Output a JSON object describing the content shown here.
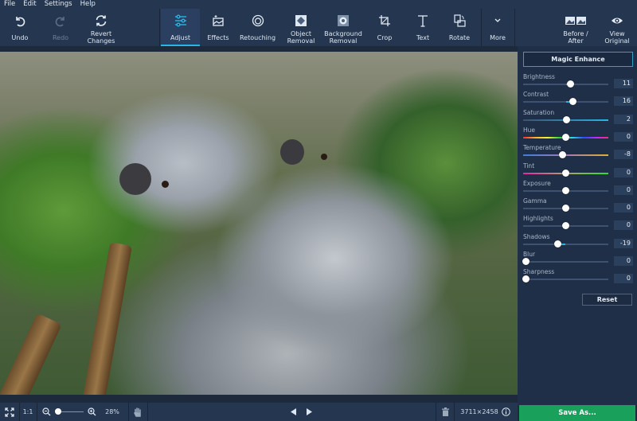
{
  "menu": [
    "File",
    "Edit",
    "Settings",
    "Help"
  ],
  "toolbar": {
    "undo": "Undo",
    "redo": "Redo",
    "revert": "Revert Changes",
    "tools": [
      {
        "label": "Adjust",
        "icon": "sliders-icon",
        "active": true
      },
      {
        "label": "Effects",
        "icon": "effects-icon"
      },
      {
        "label": "Retouching",
        "icon": "retouching-icon"
      },
      {
        "label": "Object Removal",
        "icon": "object-removal-icon"
      },
      {
        "label": "Background Removal",
        "icon": "background-removal-icon"
      },
      {
        "label": "Crop",
        "icon": "crop-icon"
      },
      {
        "label": "Text",
        "icon": "text-icon"
      },
      {
        "label": "Rotate",
        "icon": "rotate-icon"
      }
    ],
    "more": "More",
    "before_after": "Before / After",
    "view_original": "View Original"
  },
  "panel": {
    "magic_enhance": "Magic Enhance",
    "sliders": [
      {
        "name": "Brightness",
        "value": "11",
        "pos": 0.56,
        "fill_from": 0.5,
        "track": "plain"
      },
      {
        "name": "Contrast",
        "value": "16",
        "pos": 0.58,
        "fill_from": 0.5,
        "track": "plain"
      },
      {
        "name": "Saturation",
        "value": "2",
        "pos": 0.51,
        "fill_from": 0.5,
        "track": "cyan"
      },
      {
        "name": "Hue",
        "value": "0",
        "pos": 0.5,
        "track": "rainbow"
      },
      {
        "name": "Temperature",
        "value": "-8",
        "pos": 0.46,
        "track": "temp"
      },
      {
        "name": "Tint",
        "value": "0",
        "pos": 0.5,
        "track": "tint"
      },
      {
        "name": "Exposure",
        "value": "0",
        "pos": 0.5,
        "track": "plain"
      },
      {
        "name": "Gamma",
        "value": "0",
        "pos": 0.5,
        "track": "plain"
      },
      {
        "name": "Highlights",
        "value": "0",
        "pos": 0.5,
        "track": "plain"
      },
      {
        "name": "Shadows",
        "value": "-19",
        "pos": 0.41,
        "fill_from": 0.5,
        "track": "plain"
      },
      {
        "name": "Blur",
        "value": "0",
        "pos": 0.0,
        "track": "plain"
      },
      {
        "name": "Sharpness",
        "value": "0",
        "pos": 0.0,
        "track": "plain"
      }
    ],
    "reset": "Reset"
  },
  "bottom": {
    "one_to_one": "1:1",
    "zoom": "28%",
    "zoom_fraction": 0.05,
    "dimensions": "3711×2458",
    "save_as": "Save As..."
  }
}
